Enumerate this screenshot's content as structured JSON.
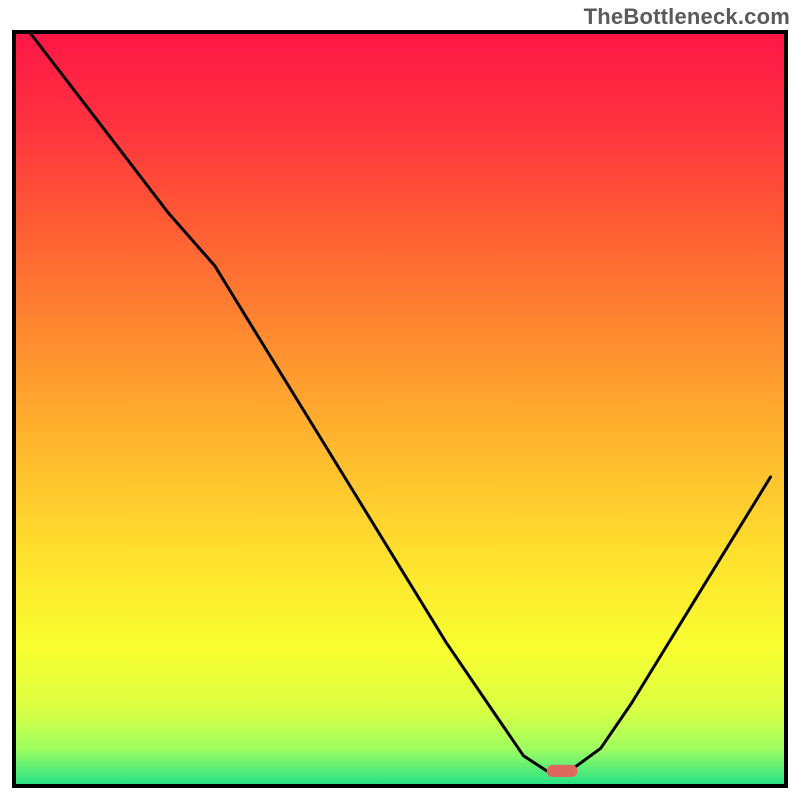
{
  "watermark": "TheBottleneck.com",
  "chart_data": {
    "type": "line",
    "title": "",
    "xlabel": "",
    "ylabel": "",
    "xlim": [
      0,
      100
    ],
    "ylim": [
      0,
      100
    ],
    "grid": false,
    "legend": null,
    "background_gradient_stops": [
      {
        "offset": 0.0,
        "color": "#ff1646"
      },
      {
        "offset": 0.12,
        "color": "#ff3240"
      },
      {
        "offset": 0.25,
        "color": "#ff5a34"
      },
      {
        "offset": 0.4,
        "color": "#ff8a30"
      },
      {
        "offset": 0.55,
        "color": "#ffb82e"
      },
      {
        "offset": 0.7,
        "color": "#ffe22e"
      },
      {
        "offset": 0.82,
        "color": "#f8ff30"
      },
      {
        "offset": 0.9,
        "color": "#d8ff44"
      },
      {
        "offset": 0.95,
        "color": "#a0ff60"
      },
      {
        "offset": 1.0,
        "color": "#22e088"
      }
    ],
    "series": [
      {
        "name": "bottleneck-curve",
        "color": "#000000",
        "stroke_width": 3,
        "x": [
          2,
          8,
          14,
          20,
          26,
          32,
          38,
          44,
          50,
          56,
          62,
          66,
          69,
          72,
          76,
          80,
          86,
          92,
          98
        ],
        "y": [
          100,
          92,
          84,
          76,
          69,
          59,
          49,
          39,
          29,
          19,
          10,
          4,
          2,
          2,
          5,
          11,
          21,
          31,
          41
        ]
      }
    ],
    "marker": {
      "name": "selected-point",
      "shape": "rounded-rect",
      "x": 71,
      "y": 2,
      "width": 4.0,
      "height": 1.6,
      "color": "#e0675d"
    },
    "axes": {
      "frame_color": "#000000",
      "frame_width": 4
    }
  }
}
